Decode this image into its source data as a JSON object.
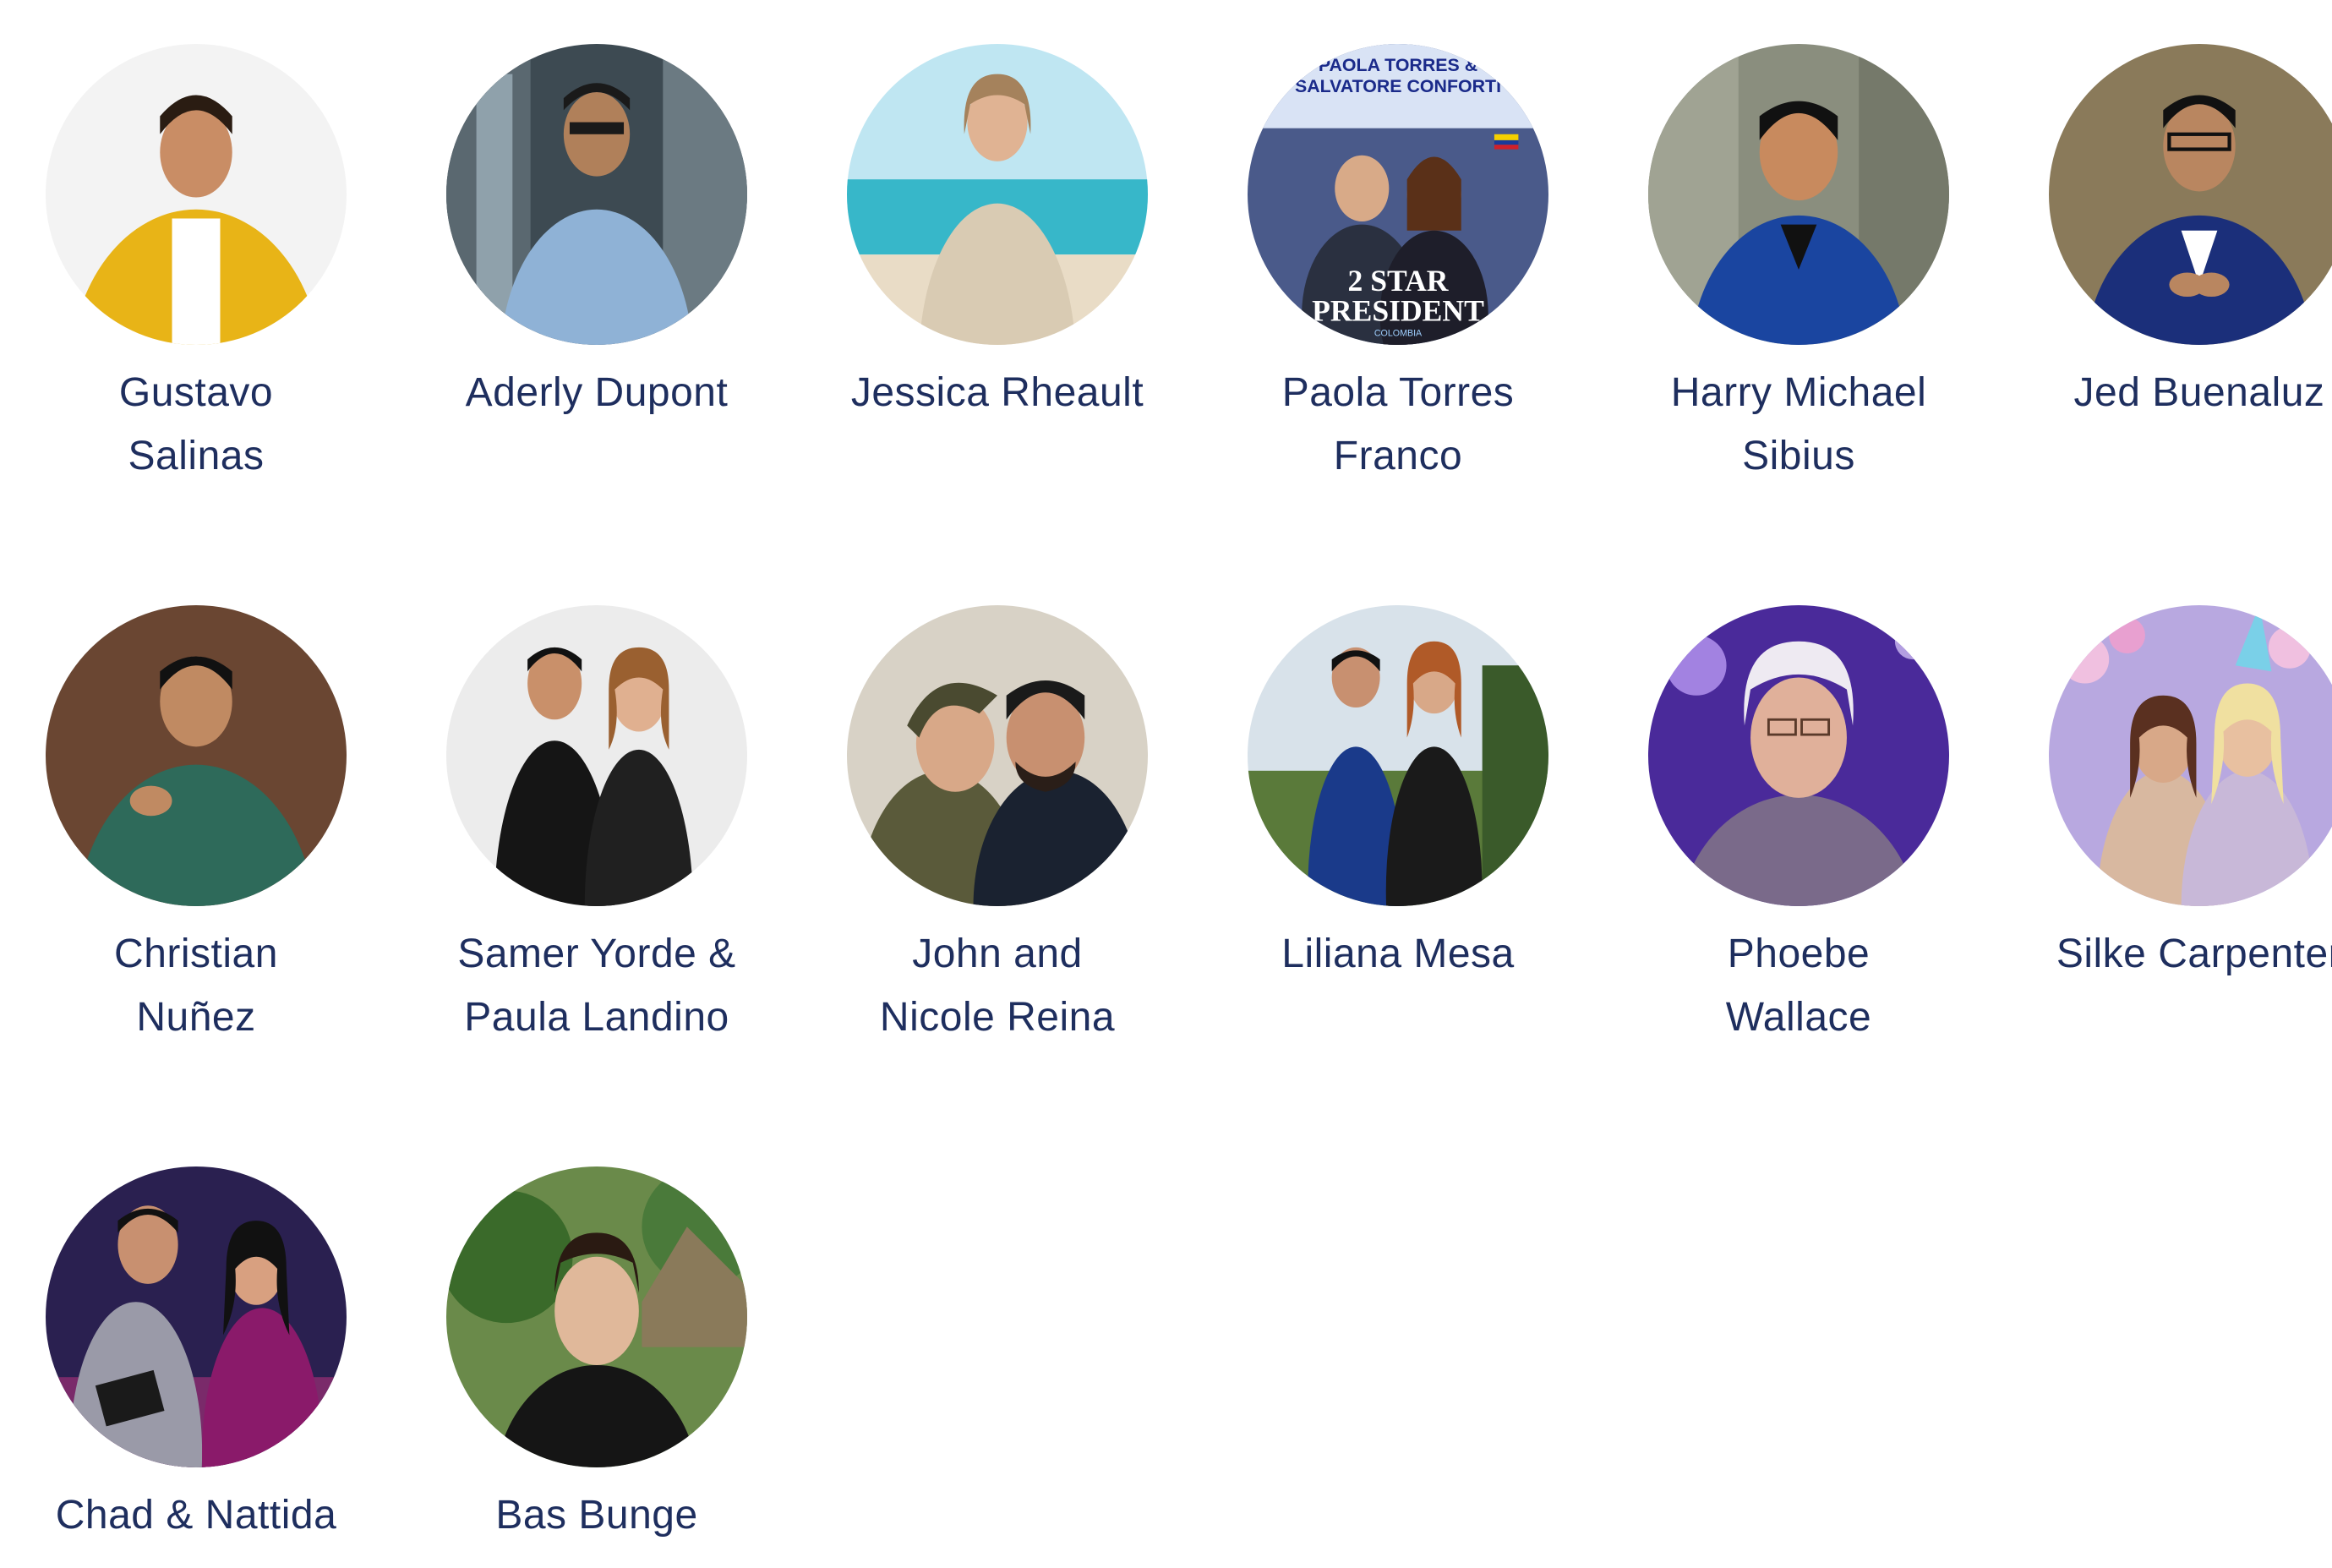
{
  "people": [
    {
      "name": "Gustavo Salinas",
      "line1": "Gustavo",
      "line2": "Salinas"
    },
    {
      "name": "Aderly Dupont",
      "line1": "Aderly Dupont",
      "line2": ""
    },
    {
      "name": "Jessica Rheault",
      "line1": "Jessica Rheault",
      "line2": ""
    },
    {
      "name": "Paola Torres Franco",
      "line1": "Paola Torres",
      "line2": "Franco"
    },
    {
      "name": "Harry Michael Sibius",
      "line1": "Harry Michael",
      "line2": "Sibius"
    },
    {
      "name": "Jed Buenaluz",
      "line1": "Jed Buenaluz",
      "line2": ""
    },
    {
      "name": "Christian Nuñez",
      "line1": "Christian",
      "line2": "Nuñez"
    },
    {
      "name": "Samer Yorde & Paula Landino",
      "line1": "Samer Yorde &",
      "line2": "Paula Landino"
    },
    {
      "name": "John and Nicole Reina",
      "line1": "John and",
      "line2": "Nicole Reina"
    },
    {
      "name": "Liliana Mesa",
      "line1": "Liliana Mesa",
      "line2": ""
    },
    {
      "name": "Phoebe Wallace",
      "line1": "Phoebe",
      "line2": "Wallace"
    },
    {
      "name": "Silke Carpenter",
      "line1": "Silke Carpenter",
      "line2": ""
    },
    {
      "name": "Chad & Nattida",
      "line1": "Chad & Nattida",
      "line2": ""
    },
    {
      "name": "Bas Bunge",
      "line1": "Bas Bunge",
      "line2": ""
    }
  ],
  "avatar_text": {
    "paola": {
      "banner_line1": "PAOLA TORRES &",
      "banner_line2": "SALVATORE CONFORTI",
      "rank_line1": "2 STAR",
      "rank_line2": "PRESIDENT",
      "country": "COLOMBIA"
    }
  },
  "colors": {
    "name_text": "#1e2e5e",
    "background": "#ffffff"
  }
}
